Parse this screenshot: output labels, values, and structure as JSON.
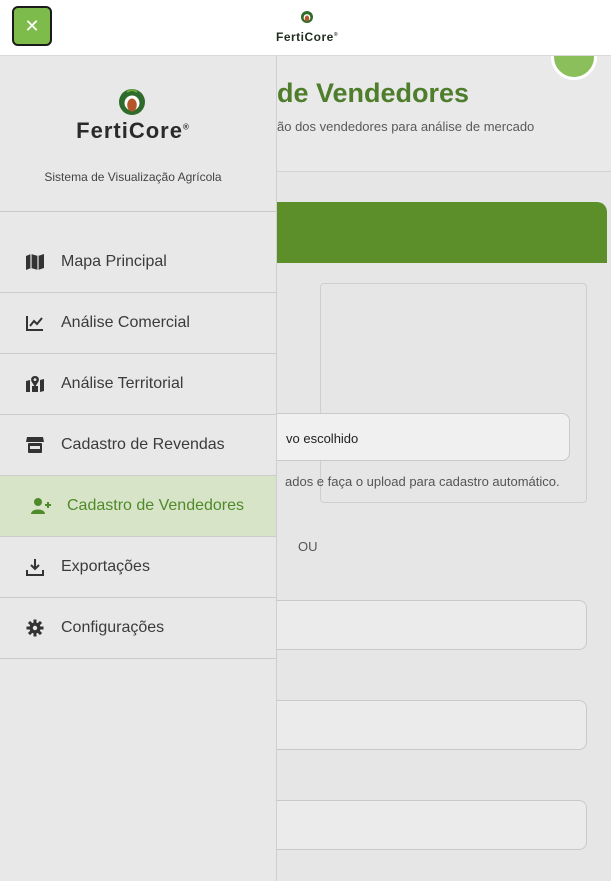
{
  "topbar": {
    "close_label": "✕",
    "brand": "FertiCore",
    "brand_mark": "®"
  },
  "background": {
    "title": "de Vendedores",
    "subtitle": "ão dos vendedores para análise de mercado",
    "file_text": "vo escolhido",
    "hint": "ados e faça o upload para cadastro automático.",
    "ou": "OU"
  },
  "sidebar": {
    "brand": "FertiCore",
    "brand_mark": "®",
    "tagline": "Sistema de Visualização Agrícola",
    "items": [
      {
        "label": "Mapa Principal",
        "icon": "map-icon"
      },
      {
        "label": "Análise Comercial",
        "icon": "chart-line-icon"
      },
      {
        "label": "Análise Territorial",
        "icon": "map-pin-icon"
      },
      {
        "label": "Cadastro de Revendas",
        "icon": "store-icon"
      },
      {
        "label": "Cadastro de Vendedores",
        "icon": "user-plus-icon",
        "active": true
      },
      {
        "label": "Exportações",
        "icon": "download-icon"
      },
      {
        "label": "Configurações",
        "icon": "gear-icon"
      }
    ]
  },
  "colors": {
    "accent": "#7dbb4a",
    "brand_green": "#5c8f2a",
    "active_bg": "#d7e4c8",
    "active_text": "#4f8a2a"
  }
}
